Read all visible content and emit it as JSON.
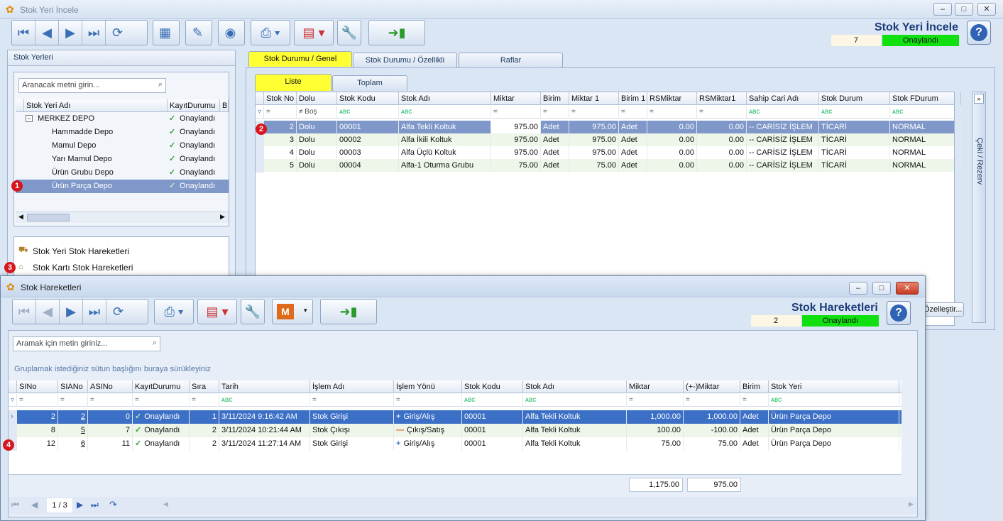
{
  "main": {
    "title": "Stok Yeri İncele",
    "big_title": "Stok Yeri İncele",
    "count": "7",
    "status": "Onaylandı",
    "left_panel_title": "Stok Yerleri",
    "search_placeholder": "Aranacak metni girin...",
    "tree_headers": [
      "Stok Yeri Adı",
      "KayıtDurumu",
      "Bl"
    ],
    "tree": [
      {
        "name": "MERKEZ DEPO",
        "status": "Onaylandı"
      },
      {
        "name": "Hammadde Depo",
        "status": "Onaylandı"
      },
      {
        "name": "Mamul Depo",
        "status": "Onaylandı"
      },
      {
        "name": "Yarı Mamul Depo",
        "status": "Onaylandı"
      },
      {
        "name": "Ürün Grubu Depo",
        "status": "Onaylandı"
      },
      {
        "name": "Ürün Parça Depo",
        "status": "Onaylandı"
      }
    ],
    "links": [
      "Stok Yeri Stok Hareketleri",
      "Stok Kartı Stok Hareketleri"
    ],
    "tabs": [
      "Stok Durumu / Genel",
      "Stok Durumu / Özellikli",
      "Raflar"
    ],
    "subtabs": [
      "Liste",
      "Toplam"
    ],
    "grid_headers": [
      "Stok No",
      "Dolu",
      "Stok Kodu",
      "Stok Adı",
      "Miktar",
      "Birim",
      "Miktar 1",
      "Birim 1",
      "RSMiktar",
      "RSMiktar1",
      "Sahip Cari Adı",
      "Stok Durum",
      "Stok FDurum"
    ],
    "filter_dolu": "Boş",
    "grid_rows": [
      [
        "2",
        "Dolu",
        "00001",
        "Alfa Tekli Koltuk",
        "975.00",
        "Adet",
        "975.00",
        "Adet",
        "0.00",
        "0.00",
        "-- CARİSİZ İŞLEM",
        "TİCARİ",
        "NORMAL"
      ],
      [
        "3",
        "Dolu",
        "00002",
        "Alfa İkili Koltuk",
        "975.00",
        "Adet",
        "975.00",
        "Adet",
        "0.00",
        "0.00",
        "-- CARİSİZ İŞLEM",
        "TİCARİ",
        "NORMAL"
      ],
      [
        "4",
        "Dolu",
        "00003",
        "Alfa Üçlü Koltuk",
        "975.00",
        "Adet",
        "975.00",
        "Adet",
        "0.00",
        "0.00",
        "-- CARİSİZ İŞLEM",
        "TİCARİ",
        "NORMAL"
      ],
      [
        "5",
        "Dolu",
        "00004",
        "Alfa-1 Oturma Grubu",
        "75.00",
        "Adet",
        "75.00",
        "Adet",
        "0.00",
        "0.00",
        "-- CARİSİZ İŞLEM",
        "TİCARİ",
        "NORMAL"
      ]
    ],
    "side_tab": "Çeki / Rezerv",
    "customize": "Özelleştir..."
  },
  "dialog": {
    "title": "Stok Hareketleri",
    "big_title": "Stok Hareketleri",
    "count": "2",
    "status": "Onaylandı",
    "search_placeholder": "Aramak için metin giriniz...",
    "group_hint": "Gruplamak istediğiniz sütun başlığını buraya sürükleyiniz",
    "headers": [
      "SINo",
      "SIANo",
      "ASINo",
      "KayıtDurumu",
      "Sıra",
      "Tarih",
      "İşlem Adı",
      "İşlem Yönü",
      "Stok Kodu",
      "Stok Adı",
      "Miktar",
      "(+-)Miktar",
      "Birim",
      "Stok Yeri"
    ],
    "rows": [
      [
        "2",
        "2",
        "0",
        "Onaylandı",
        "1",
        "3/11/2024 9:16:42 AM",
        "Stok Girişi",
        "Giriş/Alış",
        "00001",
        "Alfa Tekli Koltuk",
        "1,000.00",
        "1,000.00",
        "Adet",
        "Ürün Parça Depo"
      ],
      [
        "8",
        "5",
        "7",
        "Onaylandı",
        "2",
        "3/11/2024 10:21:44 AM",
        "Stok Çıkışı",
        "Çıkış/Satış",
        "00001",
        "Alfa Tekli Koltuk",
        "100.00",
        "-100.00",
        "Adet",
        "Ürün Parça Depo"
      ],
      [
        "12",
        "6",
        "11",
        "Onaylandı",
        "2",
        "3/11/2024 11:27:14 AM",
        "Stok Girişi",
        "Giriş/Alış",
        "00001",
        "Alfa Tekli Koltuk",
        "75.00",
        "75.00",
        "Adet",
        "Ürün Parça Depo"
      ]
    ],
    "footer_sum1": "1,175.00",
    "footer_sum2": "975.00",
    "pager": "1 / 3"
  },
  "badges": [
    "1",
    "2",
    "3",
    "4"
  ]
}
